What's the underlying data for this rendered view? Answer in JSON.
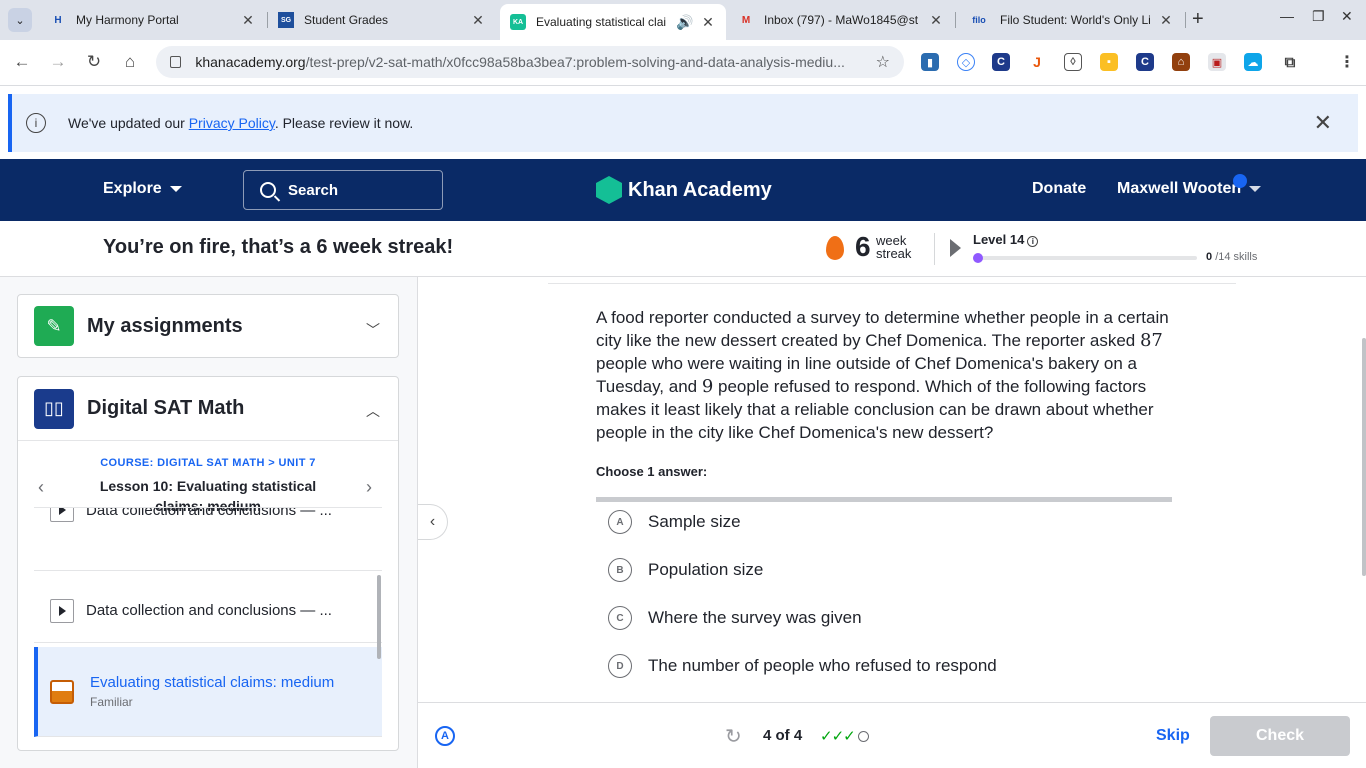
{
  "browser": {
    "tabs": [
      {
        "title": "My Harmony Portal",
        "favicon": "H"
      },
      {
        "title": "Student Grades",
        "favicon": "SG"
      },
      {
        "title": "Evaluating statistical clai",
        "favicon": "KA"
      },
      {
        "title": "Inbox (797) - MaWo1845@st",
        "favicon": "M"
      },
      {
        "title": "Filo Student: World's Only Liv",
        "favicon": "filo"
      }
    ],
    "url_host": "khanacademy.org",
    "url_path": "/test-prep/v2-sat-math/x0fcc98a58ba3bea7:problem-solving-and-data-analysis-mediu..."
  },
  "banner": {
    "prefix": "We've updated our ",
    "link": "Privacy Policy",
    "suffix": ". Please review it now."
  },
  "nav": {
    "explore": "Explore",
    "search": "Search",
    "logo": "Khan Academy",
    "donate": "Donate",
    "user": "Maxwell Wooten"
  },
  "streak": {
    "message": "You’re on fire, that’s a 6 week streak!",
    "count": "6",
    "unit_line1": "week",
    "unit_line2": "streak",
    "level": "Level 14",
    "skills_done": "0",
    "skills_total": "/14 skills",
    "level_progress": 0
  },
  "sidebar": {
    "assignments_title": "My assignments",
    "course_title": "Digital SAT Math",
    "breadcrumb": "COURSE: DIGITAL SAT MATH > UNIT 7",
    "lesson_title": "Lesson 10: Evaluating statistical claims: medium",
    "items": [
      {
        "label": "Data collection and conclusions — ..."
      },
      {
        "label": "Data collection and conclusions — ..."
      }
    ],
    "active_item": {
      "label": "Evaluating statistical claims: medium",
      "status": "Familiar"
    }
  },
  "question": {
    "part1": "A food reporter conducted a survey to determine whether people in a certain city like the new dessert created by Chef Domenica. The reporter asked ",
    "n1": "87",
    "part2": " people who were waiting in line outside of Chef Domenica's bakery on a Tuesday, and ",
    "n2": "9",
    "part3": " people refused to respond. Which of the following factors makes it least likely that a reliable conclusion can be drawn about whether people in the city like Chef Domenica's new dessert?",
    "choose_label": "Choose 1 answer:",
    "choices": [
      {
        "letter": "A",
        "text": "Sample size"
      },
      {
        "letter": "B",
        "text": "Population size"
      },
      {
        "letter": "C",
        "text": "Where the survey was given"
      },
      {
        "letter": "D",
        "text": "The number of people who refused to respond"
      }
    ]
  },
  "footer": {
    "progress": "4 of 4",
    "checks": "✓✓✓",
    "skip": "Skip",
    "check": "Check"
  }
}
